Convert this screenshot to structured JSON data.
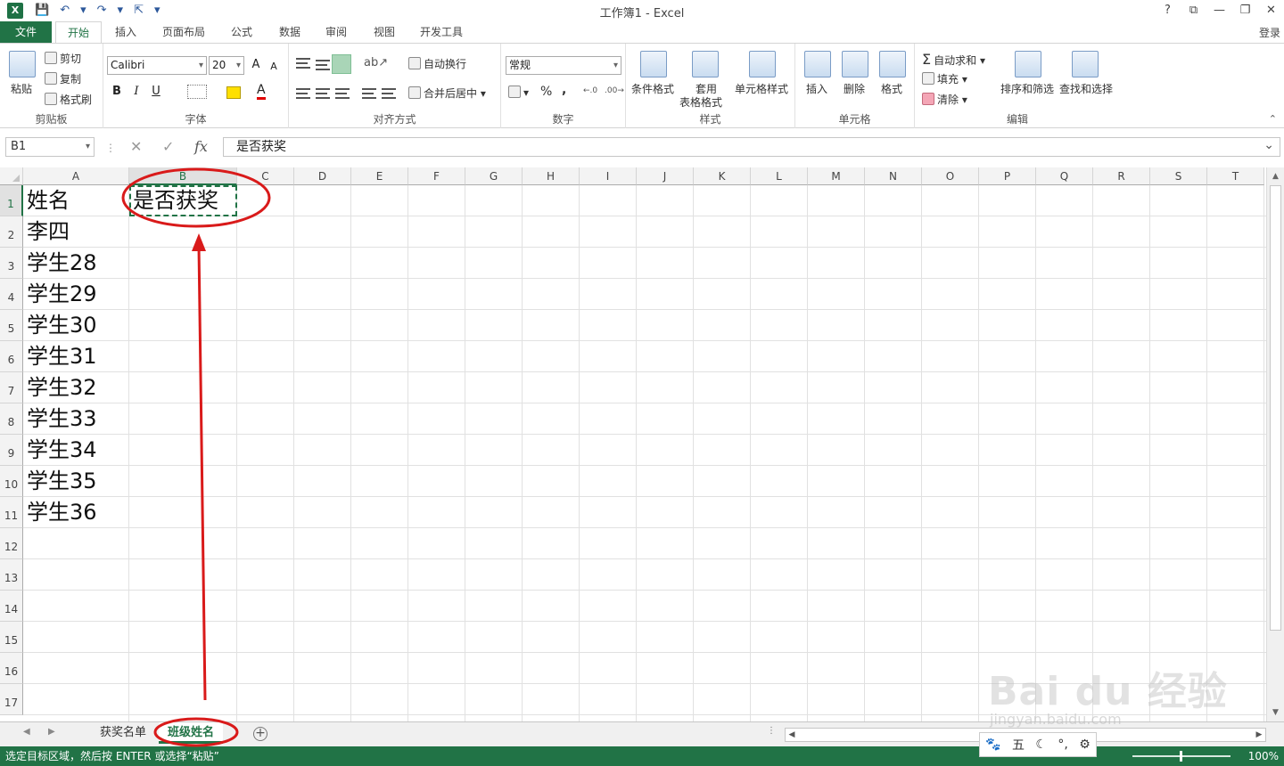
{
  "window": {
    "title": "工作簿1 - Excel",
    "controls": [
      "?",
      "⧉",
      "—",
      "❐",
      "✕"
    ]
  },
  "quick_access": [
    "💾",
    "↶",
    "▾",
    "↷",
    "▾",
    "⇱",
    "▾"
  ],
  "tabs": {
    "file": "文件",
    "items": [
      "开始",
      "插入",
      "页面布局",
      "公式",
      "数据",
      "审阅",
      "视图",
      "开发工具"
    ],
    "active": "开始",
    "login": "登录"
  },
  "ribbon": {
    "clipboard": {
      "label": "剪贴板",
      "paste": "粘贴",
      "cut": "剪切",
      "copy": "复制",
      "format_painter": "格式刷"
    },
    "font": {
      "label": "字体",
      "name": "Calibri",
      "size": "20",
      "bold": "B",
      "italic": "I",
      "underline": "U",
      "grow": "A",
      "shrink": "A"
    },
    "alignment": {
      "label": "对齐方式",
      "wrap": "自动换行",
      "merge": "合并后居中"
    },
    "number": {
      "label": "数字",
      "format": "常规",
      "percent": "%",
      "comma": ","
    },
    "styles": {
      "label": "样式",
      "conditional": "条件格式",
      "table_line1": "套用",
      "table_line2": "表格格式",
      "cell_styles": "单元格样式"
    },
    "cells": {
      "label": "单元格",
      "insert": "插入",
      "delete": "删除",
      "format": "格式"
    },
    "editing": {
      "label": "编辑",
      "autosum": "自动求和",
      "fill": "填充",
      "clear": "清除",
      "sort": "排序和筛选",
      "find": "查找和选择"
    }
  },
  "formula_bar": {
    "name_box": "B1",
    "fx": "fx",
    "value": "是否获奖"
  },
  "columns": [
    "A",
    "B",
    "C",
    "D",
    "E",
    "F",
    "G",
    "H",
    "I",
    "J",
    "K",
    "L",
    "M",
    "N",
    "O",
    "P",
    "Q",
    "R",
    "S",
    "T"
  ],
  "selected_column": "B",
  "selected_row": "1",
  "rows": [
    "1",
    "2",
    "3",
    "4",
    "5",
    "6",
    "7",
    "8",
    "9",
    "10",
    "11",
    "12",
    "13",
    "14",
    "15",
    "16",
    "17"
  ],
  "cells": {
    "A": [
      "姓名",
      "李四",
      "学生28",
      "学生29",
      "学生30",
      "学生31",
      "学生32",
      "学生33",
      "学生34",
      "学生35",
      "学生36"
    ],
    "B1": "是否获奖"
  },
  "sheets": {
    "tabs": [
      "获奖名单",
      "班级姓名"
    ],
    "active": "班级姓名",
    "add": "+"
  },
  "status": {
    "message": "选定目标区域，然后按 ENTER 或选择“粘贴”",
    "zoom": "100%"
  },
  "ime_bar": [
    "🐾",
    "五",
    "☾",
    "°,",
    "⚙"
  ],
  "watermark": {
    "text": "Bai du 经验",
    "sub": "jingyan.baidu.com"
  },
  "colors": {
    "accent": "#217346",
    "annotation": "#d91a1a"
  }
}
